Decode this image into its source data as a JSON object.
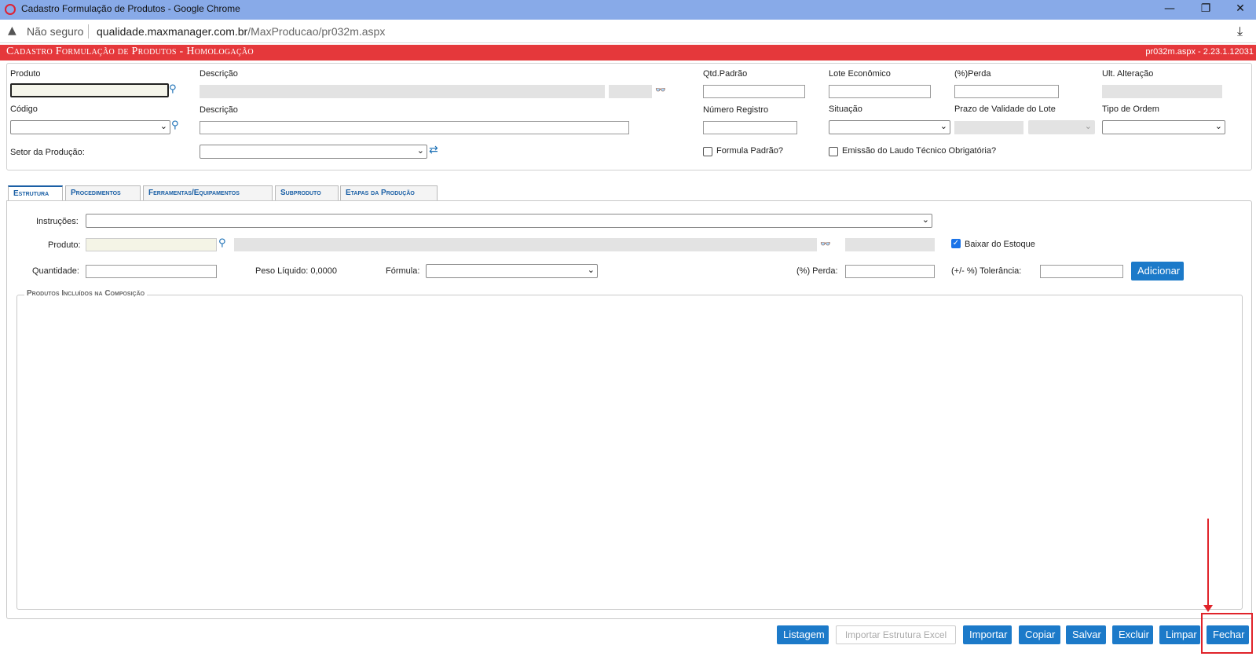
{
  "browser": {
    "window_title": "Cadastro Formulação de Produtos - Google Chrome",
    "security_label": "Não seguro",
    "url_host": "qualidade.maxmanager.com.br",
    "url_path": "/MaxProducao/pr032m.aspx",
    "minimize": "—",
    "restore": "❐",
    "close": "✕"
  },
  "header": {
    "title": "Cadastro Formulação de Produtos  - Homologação",
    "version": "pr032m.aspx - 2.23.1.12031"
  },
  "form": {
    "produto_label": "Produto",
    "descricao_label": "Descrição",
    "qtd_padrao_label": "Qtd.Padrão",
    "lote_economico_label": "Lote Econômico",
    "perda_label": "(%)Perda",
    "ult_alteracao_label": "Ult. Alteração",
    "codigo_label": "Código",
    "descricao2_label": "Descrição",
    "numero_registro_label": "Número Registro",
    "situacao_label": "Situação",
    "prazo_validade_label": "Prazo de Validade do Lote",
    "tipo_ordem_label": "Tipo de Ordem",
    "setor_producao_label": "Setor da Produção:",
    "formula_padrao_label": "Formula Padrão?",
    "formula_padrao_checked": false,
    "emissao_laudo_label": "Emissão do Laudo Técnico Obrigatória?",
    "emissao_laudo_checked": false
  },
  "tabs": [
    {
      "label": "Estrutura",
      "active": true
    },
    {
      "label": "Procedimentos",
      "active": false
    },
    {
      "label": "Ferramentas/Equipamentos",
      "active": false
    },
    {
      "label": "Subproduto",
      "active": false
    },
    {
      "label": "Etapas da Produção",
      "active": false
    }
  ],
  "estrutura": {
    "instrucoes_label": "Instruções:",
    "produto_label": "Produto:",
    "baixar_estoque_label": "Baixar do Estoque",
    "baixar_estoque_checked": true,
    "quantidade_label": "Quantidade:",
    "peso_liquido_label": "Peso Líquido: 0,0000",
    "formula_label": "Fórmula:",
    "perda_label": "(%) Perda:",
    "tolerancia_label": "(+/- %) Tolerância:",
    "adicionar_label": "Adicionar",
    "composicao_legend": "Produtos Incluídos na Composição"
  },
  "footer_buttons": {
    "listagem": "Listagem",
    "importar_excel": "Importar Estrutura Excel",
    "importar": "Importar",
    "copiar": "Copiar",
    "salvar": "Salvar",
    "excluir": "Excluir",
    "limpar": "Limpar",
    "fechar": "Fechar"
  },
  "icons": {
    "search": "search-icon",
    "binoculars": "binoculars-icon",
    "refresh": "refresh-icon",
    "warning": "warning-icon",
    "download": "download-icon"
  },
  "colors": {
    "header_red": "#e5383b",
    "button_blue": "#1c7ac9",
    "highlight_red": "#e0232a"
  }
}
